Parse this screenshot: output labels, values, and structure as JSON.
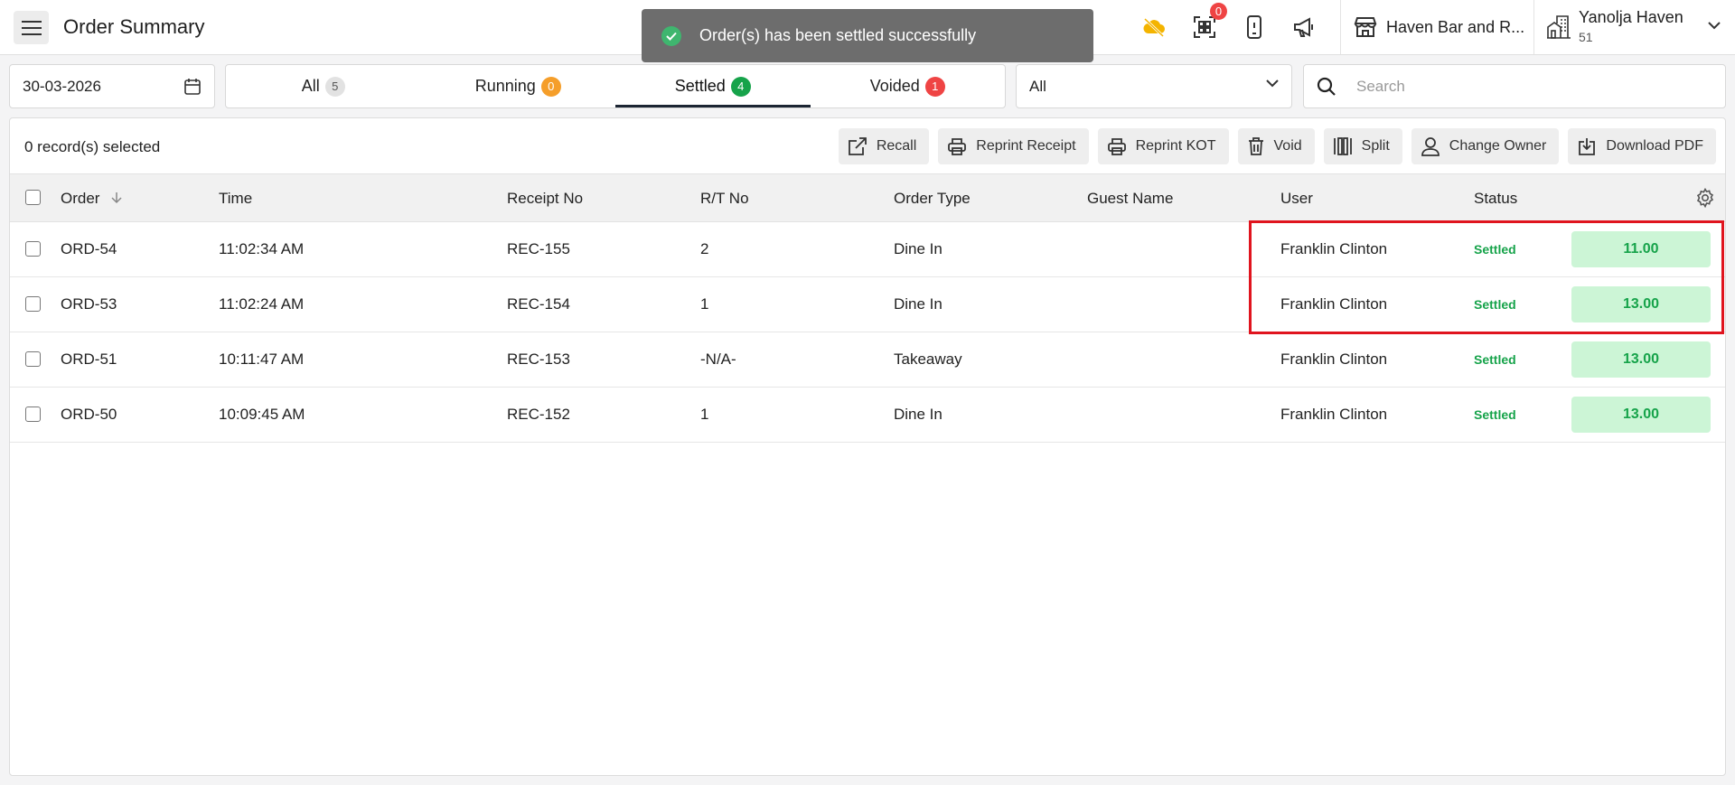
{
  "header": {
    "title": "Order Summary",
    "kot_badge": "0",
    "store_name": "Haven Bar and R...",
    "profile_name": "Yanolja Haven",
    "profile_sub": "51"
  },
  "toast": {
    "message": "Order(s) has been settled successfully"
  },
  "filters": {
    "date": "30-03-2026",
    "tabs": [
      {
        "label": "All",
        "count": "5"
      },
      {
        "label": "Running",
        "count": "0"
      },
      {
        "label": "Settled",
        "count": "4"
      },
      {
        "label": "Voided",
        "count": "1"
      }
    ],
    "order_type_filter": "All",
    "search_placeholder": "Search"
  },
  "toolbar": {
    "selected_text": "0 record(s) selected",
    "actions": [
      "Recall",
      "Reprint Receipt",
      "Reprint KOT",
      "Void",
      "Split",
      "Change Owner",
      "Download PDF"
    ]
  },
  "table": {
    "columns": [
      "Order",
      "Time",
      "Receipt No",
      "R/T No",
      "Order Type",
      "Guest Name",
      "User",
      "Status"
    ],
    "rows": [
      {
        "order": "ORD-54",
        "time": "11:02:34 AM",
        "receipt": "REC-155",
        "rt": "2",
        "type": "Dine In",
        "guest": "",
        "user": "Franklin Clinton",
        "status": "Settled",
        "amount": "11.00"
      },
      {
        "order": "ORD-53",
        "time": "11:02:24 AM",
        "receipt": "REC-154",
        "rt": "1",
        "type": "Dine In",
        "guest": "",
        "user": "Franklin Clinton",
        "status": "Settled",
        "amount": "13.00"
      },
      {
        "order": "ORD-51",
        "time": "10:11:47 AM",
        "receipt": "REC-153",
        "rt": "-N/A-",
        "type": "Takeaway",
        "guest": "",
        "user": "Franklin Clinton",
        "status": "Settled",
        "amount": "13.00"
      },
      {
        "order": "ORD-50",
        "time": "10:09:45 AM",
        "receipt": "REC-152",
        "rt": "1",
        "type": "Dine In",
        "guest": "",
        "user": "Franklin Clinton",
        "status": "Settled",
        "amount": "13.00"
      }
    ]
  },
  "colors": {
    "accent_green": "#16a34a",
    "amount_bg": "#ccf5d6",
    "highlight_red": "#e0141e",
    "toast_bg": "#6d6d6d"
  }
}
